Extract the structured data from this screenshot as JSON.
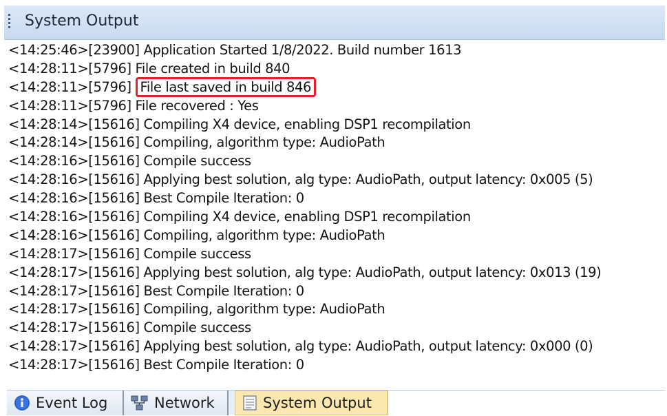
{
  "panel": {
    "title": "System Output"
  },
  "log_lines": [
    {
      "text": "<14:25:46>[23900] Application Started 1/8/2022. Build number 1613"
    },
    {
      "text": "<14:28:11>[5796] File created in build 840"
    },
    {
      "prefix": "<14:28:11>[5796] ",
      "highlight": "File last saved in build 846"
    },
    {
      "text": "<14:28:11>[5796] File recovered : Yes"
    },
    {
      "text": "<14:28:14>[15616] Compiling X4 device, enabling DSP1 recompilation"
    },
    {
      "text": "<14:28:14>[15616] Compiling, algorithm type: AudioPath"
    },
    {
      "text": "<14:28:16>[15616] Compile success"
    },
    {
      "text": "<14:28:16>[15616] Applying best solution, alg type: AudioPath, output latency: 0x005 (5)"
    },
    {
      "text": "<14:28:16>[15616] Best Compile Iteration:   0"
    },
    {
      "text": "<14:28:16>[15616] Compiling X4 device, enabling DSP1 recompilation"
    },
    {
      "text": "<14:28:16>[15616] Compiling, algorithm type: AudioPath"
    },
    {
      "text": "<14:28:17>[15616] Compile success"
    },
    {
      "text": "<14:28:17>[15616] Applying best solution, alg type: AudioPath, output latency: 0x013 (19)"
    },
    {
      "text": "<14:28:17>[15616] Best Compile Iteration:   0"
    },
    {
      "text": "<14:28:17>[15616] Compiling, algorithm type: AudioPath"
    },
    {
      "text": "<14:28:17>[15616] Compile success"
    },
    {
      "text": "<14:28:17>[15616] Applying best solution, alg type: AudioPath, output latency: 0x000 (0)"
    },
    {
      "text": "<14:28:17>[15616] Best Compile Iteration:   0"
    }
  ],
  "tabs": [
    {
      "label": "Event Log",
      "icon": "info-icon",
      "active": false
    },
    {
      "label": "Network",
      "icon": "network-icon",
      "active": false
    },
    {
      "label": "System Output",
      "icon": "document-icon",
      "active": true
    }
  ],
  "colors": {
    "highlight_border": "#e0242a",
    "active_tab": "#fbe7b0",
    "info_icon": "#2a5fc8"
  }
}
